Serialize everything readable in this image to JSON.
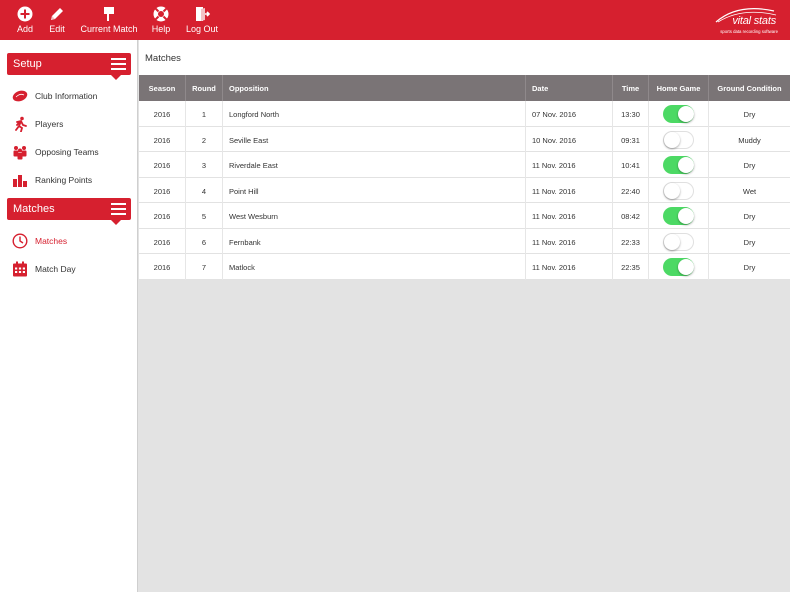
{
  "toolbar": {
    "add_label": "Add",
    "edit_label": "Edit",
    "current_match_label": "Current Match",
    "help_label": "Help",
    "logout_label": "Log Out",
    "brand_name": "vital stats",
    "brand_tagline": "sports data recording software"
  },
  "sidebar": {
    "setup_header": "Setup",
    "setup_items": [
      {
        "label": "Club Information",
        "icon": "football-icon"
      },
      {
        "label": "Players",
        "icon": "runner-icon"
      },
      {
        "label": "Opposing Teams",
        "icon": "team-icon"
      },
      {
        "label": "Ranking Points",
        "icon": "bar-chart-icon"
      }
    ],
    "matches_header": "Matches",
    "matches_items": [
      {
        "label": "Matches",
        "icon": "clock-icon",
        "active": true
      },
      {
        "label": "Match Day",
        "icon": "calendar-icon",
        "active": false
      }
    ]
  },
  "main": {
    "title": "Matches",
    "columns": [
      "Season",
      "Round",
      "Opposition",
      "Date",
      "Time",
      "Home Game",
      "Ground Condition"
    ],
    "rows": [
      {
        "season": "2016",
        "round": "1",
        "opposition": "Longford North",
        "date": "07 Nov. 2016",
        "time": "13:30",
        "home_game": true,
        "ground": "Dry"
      },
      {
        "season": "2016",
        "round": "2",
        "opposition": "Seville East",
        "date": "10 Nov. 2016",
        "time": "09:31",
        "home_game": false,
        "ground": "Muddy"
      },
      {
        "season": "2016",
        "round": "3",
        "opposition": "Riverdale East",
        "date": "11 Nov. 2016",
        "time": "10:41",
        "home_game": true,
        "ground": "Dry"
      },
      {
        "season": "2016",
        "round": "4",
        "opposition": "Point Hill",
        "date": "11 Nov. 2016",
        "time": "22:40",
        "home_game": false,
        "ground": "Wet"
      },
      {
        "season": "2016",
        "round": "5",
        "opposition": "West Wesburn",
        "date": "11 Nov. 2016",
        "time": "08:42",
        "home_game": true,
        "ground": "Dry"
      },
      {
        "season": "2016",
        "round": "6",
        "opposition": "Fernbank",
        "date": "11 Nov. 2016",
        "time": "22:33",
        "home_game": false,
        "ground": "Dry"
      },
      {
        "season": "2016",
        "round": "7",
        "opposition": "Matlock",
        "date": "11 Nov. 2016",
        "time": "22:35",
        "home_game": true,
        "ground": "Dry"
      }
    ]
  },
  "colors": {
    "accent": "#d6202f",
    "header_gray": "#7a7476",
    "toggle_on": "#4cd964",
    "background": "#e3e3e3"
  }
}
